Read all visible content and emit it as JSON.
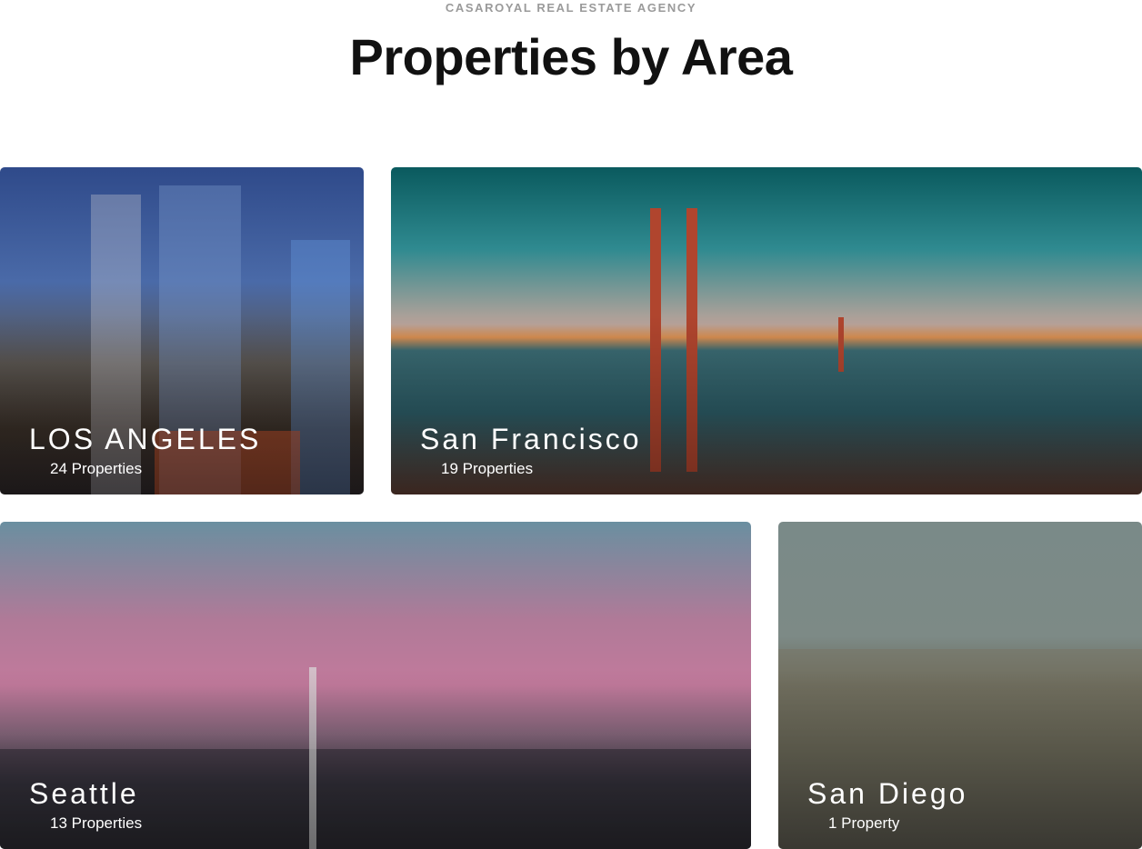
{
  "header": {
    "eyebrow": "CASAROYAL REAL ESTATE AGENCY",
    "title_bold": "Properties",
    "title_rest": " by Area"
  },
  "areas": [
    {
      "name": "LOS ANGELES",
      "count": "24 Properties"
    },
    {
      "name": "San Francisco",
      "count": "19 Properties"
    },
    {
      "name": "Seattle",
      "count": "13 Properties"
    },
    {
      "name": "San Diego",
      "count": "1 Property"
    }
  ]
}
